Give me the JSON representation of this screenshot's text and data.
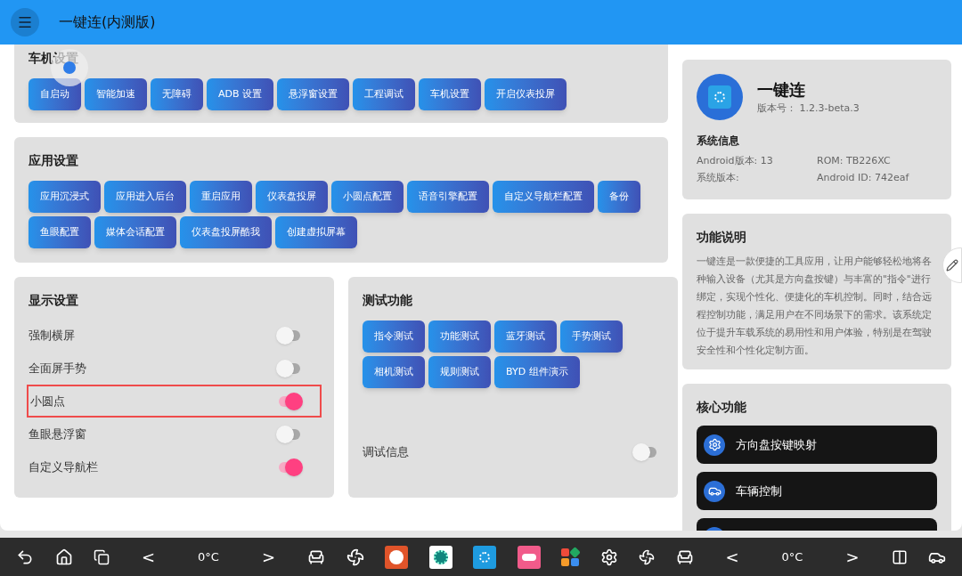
{
  "app_bar": {
    "title": "一键连(内测版)"
  },
  "vehicle_settings": {
    "title": "车机设置",
    "buttons": [
      "自启动",
      "智能加速",
      "无障碍",
      "ADB 设置",
      "悬浮窗设置",
      "工程调试",
      "车机设置",
      "开启仪表投屏"
    ]
  },
  "app_settings": {
    "title": "应用设置",
    "buttons": [
      "应用沉浸式",
      "应用进入后台",
      "重启应用",
      "仪表盘投屏",
      "小圆点配置",
      "语音引擎配置",
      "自定义导航栏配置",
      "备份",
      "鱼眼配置",
      "媒体会话配置",
      "仪表盘投屏酷我",
      "创建虚拟屏幕"
    ]
  },
  "display_settings": {
    "title": "显示设置",
    "toggles": [
      {
        "label": "强制横屏",
        "on": false,
        "highlighted": false
      },
      {
        "label": "全面屏手势",
        "on": false,
        "highlighted": false
      },
      {
        "label": "小圆点",
        "on": true,
        "highlighted": true
      },
      {
        "label": "鱼眼悬浮窗",
        "on": false,
        "highlighted": false
      },
      {
        "label": "自定义导航栏",
        "on": true,
        "highlighted": false
      }
    ]
  },
  "test_functions": {
    "title": "测试功能",
    "buttons": [
      "指令测试",
      "功能测试",
      "蓝牙测试",
      "手势测试",
      "相机测试",
      "规则测试",
      "BYD 组件演示"
    ],
    "debug_toggle": {
      "label": "调试信息",
      "on": false
    }
  },
  "app_info": {
    "name": "一键连",
    "version": "版本号： 1.2.3-beta.3",
    "system_title": "系统信息",
    "fields": [
      "Android版本: 13",
      "ROM: TB226XC",
      "系统版本:",
      "Android ID: 742eaf"
    ]
  },
  "description": {
    "title": "功能说明",
    "text": "一键连是一款便捷的工具应用，让用户能够轻松地将各种输入设备（尤其是方向盘按键）与丰富的\"指令\"进行绑定，实现个性化、便捷化的车机控制。同时，结合远程控制功能，满足用户在不同场景下的需求。该系统定位于提升车载系统的易用性和用户体验，特别是在驾驶安全性和个性化定制方面。"
  },
  "core_features": {
    "title": "核心功能",
    "items": [
      {
        "kind": "gear",
        "label": "方向盘按键映射"
      },
      {
        "kind": "car",
        "label": "车辆控制"
      },
      {
        "kind": "partial"
      }
    ]
  },
  "taskbar": {
    "left_climate": {
      "decrease": "<",
      "temperature": "0°C",
      "increase": ">"
    },
    "right_climate": {
      "decrease": "<",
      "temperature": "0°C",
      "increase": ">"
    }
  }
}
